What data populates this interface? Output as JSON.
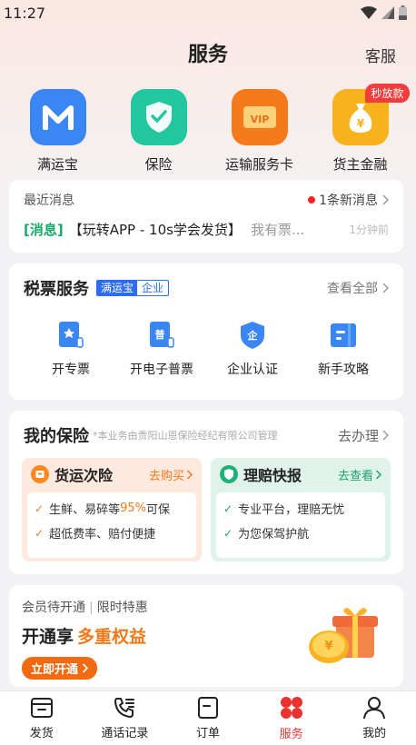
{
  "status": {
    "time": "11:27"
  },
  "header": {
    "title": "服务",
    "customer_service": "客服"
  },
  "top_services": [
    {
      "label": "满运宝",
      "icon": "m-logo-icon",
      "color": "#3a86f5"
    },
    {
      "label": "保险",
      "icon": "shield-check-icon",
      "color": "#22c7a0"
    },
    {
      "label": "运输服务卡",
      "icon": "vip-card-icon",
      "color": "#f77a1a"
    },
    {
      "label": "货主金融",
      "icon": "money-bag-icon",
      "color": "#f7b21c",
      "badge": "秒放款"
    }
  ],
  "messages": {
    "title": "最近消息",
    "new_count": "1条新消息",
    "tag": "[消息]",
    "text": "【玩转APP - 10s学会发货】",
    "preview": "我有票...",
    "time": "1分钟前"
  },
  "tax": {
    "title": "税票服务",
    "brand_a": "满运宝",
    "brand_b": "企业",
    "view_all": "查看全部",
    "items": [
      {
        "label": "开专票",
        "icon": "special-invoice-icon"
      },
      {
        "label": "开电子普票",
        "icon": "e-invoice-icon"
      },
      {
        "label": "企业认证",
        "icon": "enterprise-verify-icon"
      },
      {
        "label": "新手攻略",
        "icon": "guide-book-icon"
      }
    ]
  },
  "insurance": {
    "title": "我的保险",
    "note": "*本业务由贵阳山恩保险经纪有限公司管理",
    "action": "去办理",
    "cargo": {
      "title": "货运次险",
      "go": "去购买",
      "line1_a": "生鲜、易碎等",
      "line1_hl": "95%",
      "line1_b": "可保",
      "line2": "超低费率、赔付便捷"
    },
    "claims": {
      "title": "理赔快报",
      "go": "去查看",
      "line1": "专业平台，理赔无忧",
      "line2": "为您保驾护航"
    }
  },
  "vip": {
    "sub_a": "会员待开通",
    "sub_b": "限时特惠",
    "title_a": "开通享",
    "title_b": "多重权益",
    "button": "立即开通"
  },
  "tabs": [
    {
      "label": "发货",
      "icon": "box-icon"
    },
    {
      "label": "通话记录",
      "icon": "phone-log-icon"
    },
    {
      "label": "订单",
      "icon": "order-icon"
    },
    {
      "label": "服务",
      "icon": "service-dots-icon",
      "active": true
    },
    {
      "label": "我的",
      "icon": "user-icon"
    }
  ]
}
